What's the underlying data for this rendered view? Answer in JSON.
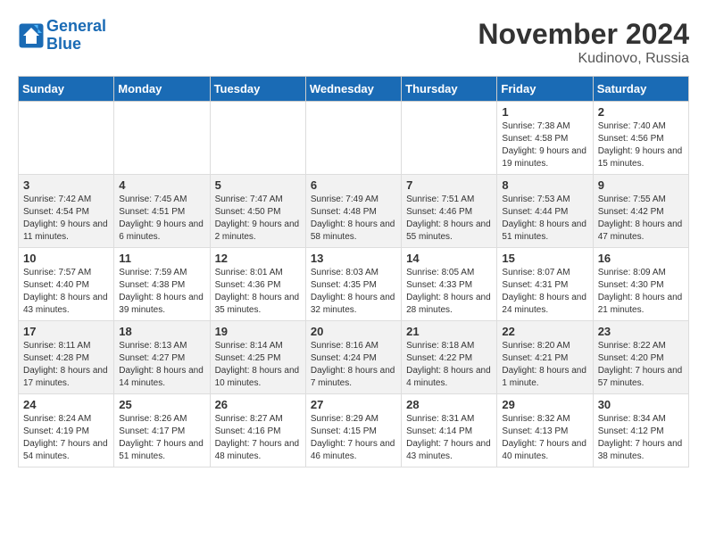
{
  "logo": {
    "line1": "General",
    "line2": "Blue"
  },
  "title": "November 2024",
  "location": "Kudinovo, Russia",
  "days_header": [
    "Sunday",
    "Monday",
    "Tuesday",
    "Wednesday",
    "Thursday",
    "Friday",
    "Saturday"
  ],
  "weeks": [
    [
      {
        "day": "",
        "sunrise": "",
        "sunset": "",
        "daylight": ""
      },
      {
        "day": "",
        "sunrise": "",
        "sunset": "",
        "daylight": ""
      },
      {
        "day": "",
        "sunrise": "",
        "sunset": "",
        "daylight": ""
      },
      {
        "day": "",
        "sunrise": "",
        "sunset": "",
        "daylight": ""
      },
      {
        "day": "",
        "sunrise": "",
        "sunset": "",
        "daylight": ""
      },
      {
        "day": "1",
        "sunrise": "Sunrise: 7:38 AM",
        "sunset": "Sunset: 4:58 PM",
        "daylight": "Daylight: 9 hours and 19 minutes."
      },
      {
        "day": "2",
        "sunrise": "Sunrise: 7:40 AM",
        "sunset": "Sunset: 4:56 PM",
        "daylight": "Daylight: 9 hours and 15 minutes."
      }
    ],
    [
      {
        "day": "3",
        "sunrise": "Sunrise: 7:42 AM",
        "sunset": "Sunset: 4:54 PM",
        "daylight": "Daylight: 9 hours and 11 minutes."
      },
      {
        "day": "4",
        "sunrise": "Sunrise: 7:45 AM",
        "sunset": "Sunset: 4:51 PM",
        "daylight": "Daylight: 9 hours and 6 minutes."
      },
      {
        "day": "5",
        "sunrise": "Sunrise: 7:47 AM",
        "sunset": "Sunset: 4:50 PM",
        "daylight": "Daylight: 9 hours and 2 minutes."
      },
      {
        "day": "6",
        "sunrise": "Sunrise: 7:49 AM",
        "sunset": "Sunset: 4:48 PM",
        "daylight": "Daylight: 8 hours and 58 minutes."
      },
      {
        "day": "7",
        "sunrise": "Sunrise: 7:51 AM",
        "sunset": "Sunset: 4:46 PM",
        "daylight": "Daylight: 8 hours and 55 minutes."
      },
      {
        "day": "8",
        "sunrise": "Sunrise: 7:53 AM",
        "sunset": "Sunset: 4:44 PM",
        "daylight": "Daylight: 8 hours and 51 minutes."
      },
      {
        "day": "9",
        "sunrise": "Sunrise: 7:55 AM",
        "sunset": "Sunset: 4:42 PM",
        "daylight": "Daylight: 8 hours and 47 minutes."
      }
    ],
    [
      {
        "day": "10",
        "sunrise": "Sunrise: 7:57 AM",
        "sunset": "Sunset: 4:40 PM",
        "daylight": "Daylight: 8 hours and 43 minutes."
      },
      {
        "day": "11",
        "sunrise": "Sunrise: 7:59 AM",
        "sunset": "Sunset: 4:38 PM",
        "daylight": "Daylight: 8 hours and 39 minutes."
      },
      {
        "day": "12",
        "sunrise": "Sunrise: 8:01 AM",
        "sunset": "Sunset: 4:36 PM",
        "daylight": "Daylight: 8 hours and 35 minutes."
      },
      {
        "day": "13",
        "sunrise": "Sunrise: 8:03 AM",
        "sunset": "Sunset: 4:35 PM",
        "daylight": "Daylight: 8 hours and 32 minutes."
      },
      {
        "day": "14",
        "sunrise": "Sunrise: 8:05 AM",
        "sunset": "Sunset: 4:33 PM",
        "daylight": "Daylight: 8 hours and 28 minutes."
      },
      {
        "day": "15",
        "sunrise": "Sunrise: 8:07 AM",
        "sunset": "Sunset: 4:31 PM",
        "daylight": "Daylight: 8 hours and 24 minutes."
      },
      {
        "day": "16",
        "sunrise": "Sunrise: 8:09 AM",
        "sunset": "Sunset: 4:30 PM",
        "daylight": "Daylight: 8 hours and 21 minutes."
      }
    ],
    [
      {
        "day": "17",
        "sunrise": "Sunrise: 8:11 AM",
        "sunset": "Sunset: 4:28 PM",
        "daylight": "Daylight: 8 hours and 17 minutes."
      },
      {
        "day": "18",
        "sunrise": "Sunrise: 8:13 AM",
        "sunset": "Sunset: 4:27 PM",
        "daylight": "Daylight: 8 hours and 14 minutes."
      },
      {
        "day": "19",
        "sunrise": "Sunrise: 8:14 AM",
        "sunset": "Sunset: 4:25 PM",
        "daylight": "Daylight: 8 hours and 10 minutes."
      },
      {
        "day": "20",
        "sunrise": "Sunrise: 8:16 AM",
        "sunset": "Sunset: 4:24 PM",
        "daylight": "Daylight: 8 hours and 7 minutes."
      },
      {
        "day": "21",
        "sunrise": "Sunrise: 8:18 AM",
        "sunset": "Sunset: 4:22 PM",
        "daylight": "Daylight: 8 hours and 4 minutes."
      },
      {
        "day": "22",
        "sunrise": "Sunrise: 8:20 AM",
        "sunset": "Sunset: 4:21 PM",
        "daylight": "Daylight: 8 hours and 1 minute."
      },
      {
        "day": "23",
        "sunrise": "Sunrise: 8:22 AM",
        "sunset": "Sunset: 4:20 PM",
        "daylight": "Daylight: 7 hours and 57 minutes."
      }
    ],
    [
      {
        "day": "24",
        "sunrise": "Sunrise: 8:24 AM",
        "sunset": "Sunset: 4:19 PM",
        "daylight": "Daylight: 7 hours and 54 minutes."
      },
      {
        "day": "25",
        "sunrise": "Sunrise: 8:26 AM",
        "sunset": "Sunset: 4:17 PM",
        "daylight": "Daylight: 7 hours and 51 minutes."
      },
      {
        "day": "26",
        "sunrise": "Sunrise: 8:27 AM",
        "sunset": "Sunset: 4:16 PM",
        "daylight": "Daylight: 7 hours and 48 minutes."
      },
      {
        "day": "27",
        "sunrise": "Sunrise: 8:29 AM",
        "sunset": "Sunset: 4:15 PM",
        "daylight": "Daylight: 7 hours and 46 minutes."
      },
      {
        "day": "28",
        "sunrise": "Sunrise: 8:31 AM",
        "sunset": "Sunset: 4:14 PM",
        "daylight": "Daylight: 7 hours and 43 minutes."
      },
      {
        "day": "29",
        "sunrise": "Sunrise: 8:32 AM",
        "sunset": "Sunset: 4:13 PM",
        "daylight": "Daylight: 7 hours and 40 minutes."
      },
      {
        "day": "30",
        "sunrise": "Sunrise: 8:34 AM",
        "sunset": "Sunset: 4:12 PM",
        "daylight": "Daylight: 7 hours and 38 minutes."
      }
    ]
  ]
}
